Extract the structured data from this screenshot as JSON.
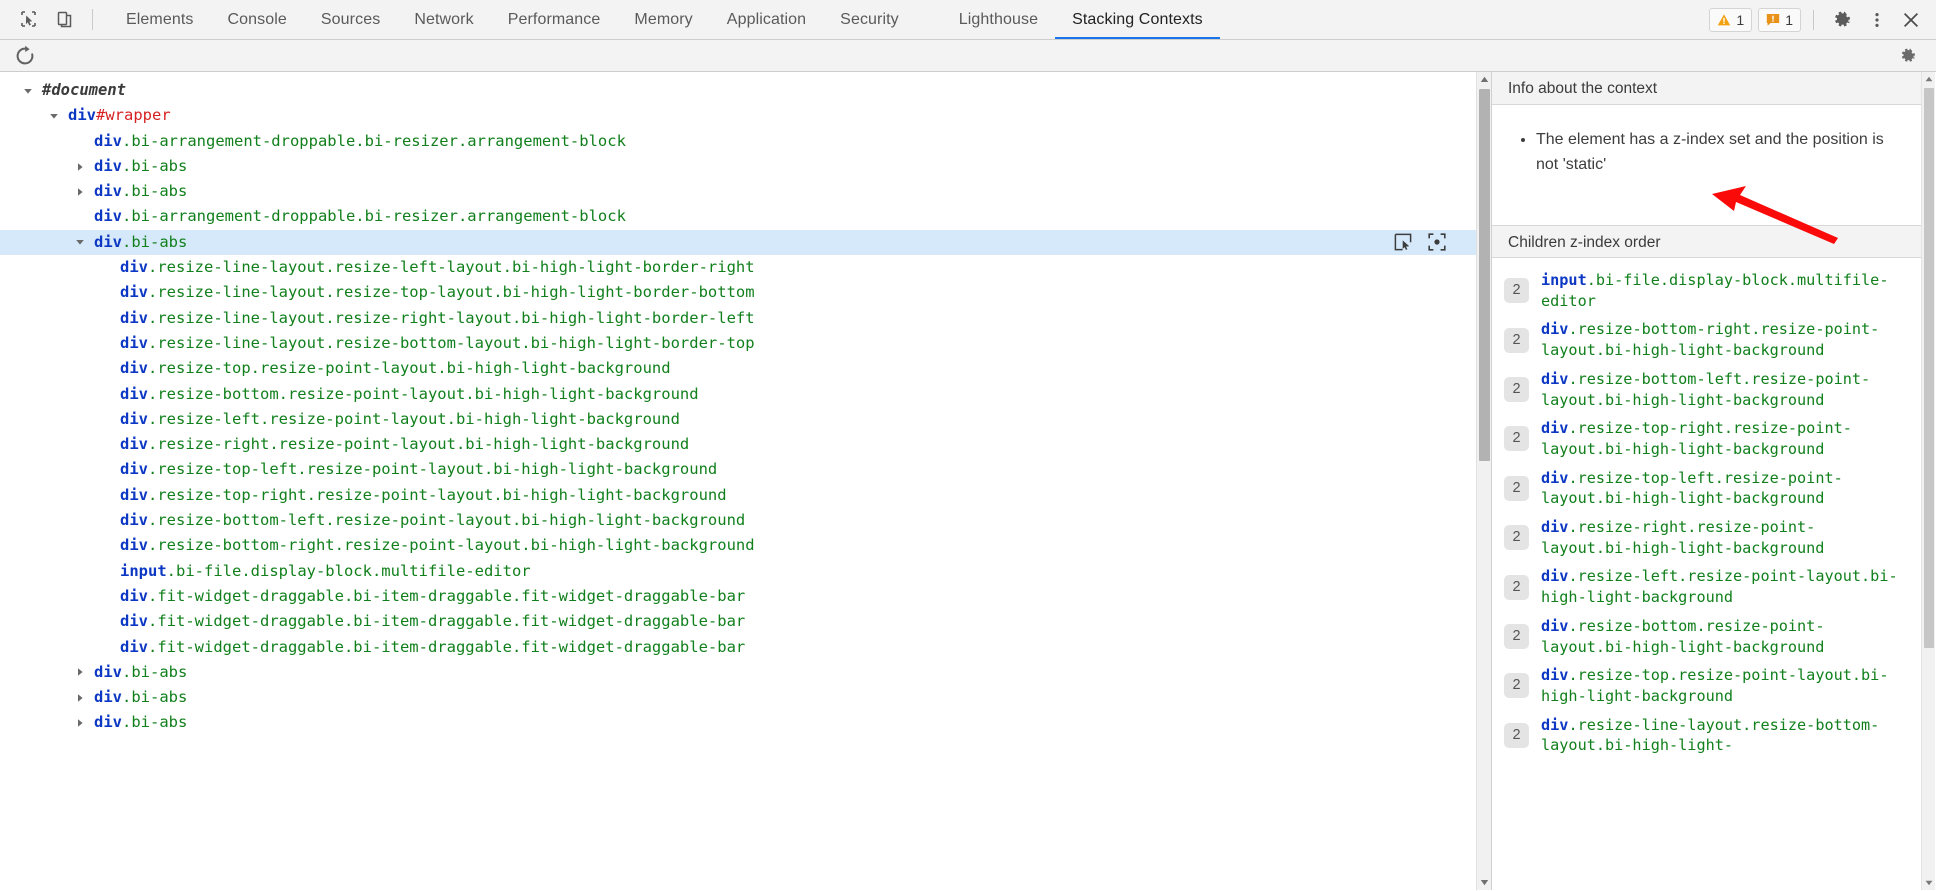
{
  "toolbar": {
    "inspect_icon": "inspect-cursor-icon",
    "device_icon": "device-toolbar-icon",
    "tabs": [
      {
        "label": "Elements",
        "active": false
      },
      {
        "label": "Console",
        "active": false
      },
      {
        "label": "Sources",
        "active": false
      },
      {
        "label": "Network",
        "active": false
      },
      {
        "label": "Performance",
        "active": false
      },
      {
        "label": "Memory",
        "active": false
      },
      {
        "label": "Application",
        "active": false
      },
      {
        "label": "Security",
        "active": false
      },
      {
        "label": "Lighthouse",
        "active": false
      },
      {
        "label": "Stacking Contexts",
        "active": true
      }
    ],
    "warning_count": "1",
    "error_count": "1",
    "warning_icon": "warning-triangle-icon",
    "error_icon": "error-message-icon",
    "settings_icon": "gear-icon",
    "more_icon": "kebab-menu-icon",
    "close_icon": "close-icon",
    "accent_color": "#1a73e8",
    "warning_color": "#f2a010",
    "error_color": "#e8921a"
  },
  "subbar": {
    "reload_icon": "reload-icon",
    "settings_icon": "gear-icon"
  },
  "tree": {
    "rows": [
      {
        "indent": 0,
        "twisty": "open",
        "kind": "document",
        "text": "#document"
      },
      {
        "indent": 1,
        "twisty": "open",
        "kind": "element",
        "tag": "div",
        "id": "#wrapper",
        "classes": ""
      },
      {
        "indent": 2,
        "twisty": "none",
        "kind": "element",
        "tag": "div",
        "id": "",
        "classes": ".bi-arrangement-droppable.bi-resizer.arrangement-block"
      },
      {
        "indent": 2,
        "twisty": "closed",
        "kind": "element",
        "tag": "div",
        "id": "",
        "classes": ".bi-abs"
      },
      {
        "indent": 2,
        "twisty": "closed",
        "kind": "element",
        "tag": "div",
        "id": "",
        "classes": ".bi-abs"
      },
      {
        "indent": 2,
        "twisty": "none",
        "kind": "element",
        "tag": "div",
        "id": "",
        "classes": ".bi-arrangement-droppable.bi-resizer.arrangement-block"
      },
      {
        "indent": 2,
        "twisty": "open",
        "kind": "element",
        "tag": "div",
        "id": "",
        "classes": ".bi-abs",
        "selected": true
      },
      {
        "indent": 3,
        "twisty": "none",
        "kind": "element",
        "tag": "div",
        "id": "",
        "classes": ".resize-line-layout.resize-left-layout.bi-high-light-border-right"
      },
      {
        "indent": 3,
        "twisty": "none",
        "kind": "element",
        "tag": "div",
        "id": "",
        "classes": ".resize-line-layout.resize-top-layout.bi-high-light-border-bottom"
      },
      {
        "indent": 3,
        "twisty": "none",
        "kind": "element",
        "tag": "div",
        "id": "",
        "classes": ".resize-line-layout.resize-right-layout.bi-high-light-border-left"
      },
      {
        "indent": 3,
        "twisty": "none",
        "kind": "element",
        "tag": "div",
        "id": "",
        "classes": ".resize-line-layout.resize-bottom-layout.bi-high-light-border-top"
      },
      {
        "indent": 3,
        "twisty": "none",
        "kind": "element",
        "tag": "div",
        "id": "",
        "classes": ".resize-top.resize-point-layout.bi-high-light-background"
      },
      {
        "indent": 3,
        "twisty": "none",
        "kind": "element",
        "tag": "div",
        "id": "",
        "classes": ".resize-bottom.resize-point-layout.bi-high-light-background"
      },
      {
        "indent": 3,
        "twisty": "none",
        "kind": "element",
        "tag": "div",
        "id": "",
        "classes": ".resize-left.resize-point-layout.bi-high-light-background"
      },
      {
        "indent": 3,
        "twisty": "none",
        "kind": "element",
        "tag": "div",
        "id": "",
        "classes": ".resize-right.resize-point-layout.bi-high-light-background"
      },
      {
        "indent": 3,
        "twisty": "none",
        "kind": "element",
        "tag": "div",
        "id": "",
        "classes": ".resize-top-left.resize-point-layout.bi-high-light-background"
      },
      {
        "indent": 3,
        "twisty": "none",
        "kind": "element",
        "tag": "div",
        "id": "",
        "classes": ".resize-top-right.resize-point-layout.bi-high-light-background"
      },
      {
        "indent": 3,
        "twisty": "none",
        "kind": "element",
        "tag": "div",
        "id": "",
        "classes": ".resize-bottom-left.resize-point-layout.bi-high-light-background"
      },
      {
        "indent": 3,
        "twisty": "none",
        "kind": "element",
        "tag": "div",
        "id": "",
        "classes": ".resize-bottom-right.resize-point-layout.bi-high-light-background"
      },
      {
        "indent": 3,
        "twisty": "none",
        "kind": "element",
        "tag": "input",
        "id": "",
        "classes": ".bi-file.display-block.multifile-editor"
      },
      {
        "indent": 3,
        "twisty": "none",
        "kind": "element",
        "tag": "div",
        "id": "",
        "classes": ".fit-widget-draggable.bi-item-draggable.fit-widget-draggable-bar"
      },
      {
        "indent": 3,
        "twisty": "none",
        "kind": "element",
        "tag": "div",
        "id": "",
        "classes": ".fit-widget-draggable.bi-item-draggable.fit-widget-draggable-bar"
      },
      {
        "indent": 3,
        "twisty": "none",
        "kind": "element",
        "tag": "div",
        "id": "",
        "classes": ".fit-widget-draggable.bi-item-draggable.fit-widget-draggable-bar"
      },
      {
        "indent": 2,
        "twisty": "closed",
        "kind": "element",
        "tag": "div",
        "id": "",
        "classes": ".bi-abs"
      },
      {
        "indent": 2,
        "twisty": "closed",
        "kind": "element",
        "tag": "div",
        "id": "",
        "classes": ".bi-abs"
      },
      {
        "indent": 2,
        "twisty": "closed",
        "kind": "element",
        "tag": "div",
        "id": "",
        "classes": ".bi-abs"
      }
    ],
    "selected_row_icons": {
      "select_icon": "select-node-icon",
      "scroll_into_view_icon": "scroll-into-view-icon"
    }
  },
  "info_panel": {
    "info_header": "Info about the context",
    "info_bullets": [
      "The element has a z-index set and the position is not 'static'"
    ],
    "children_header": "Children z-index order",
    "children": [
      {
        "z": "2",
        "tag": "input",
        "classes": ".bi-file.display-block.multifile-editor"
      },
      {
        "z": "2",
        "tag": "div",
        "classes": ".resize-bottom-right.resize-point-layout.bi-high-light-background"
      },
      {
        "z": "2",
        "tag": "div",
        "classes": ".resize-bottom-left.resize-point-layout.bi-high-light-background"
      },
      {
        "z": "2",
        "tag": "div",
        "classes": ".resize-top-right.resize-point-layout.bi-high-light-background"
      },
      {
        "z": "2",
        "tag": "div",
        "classes": ".resize-top-left.resize-point-layout.bi-high-light-background"
      },
      {
        "z": "2",
        "tag": "div",
        "classes": ".resize-right.resize-point-layout.bi-high-light-background"
      },
      {
        "z": "2",
        "tag": "div",
        "classes": ".resize-left.resize-point-layout.bi-high-light-background"
      },
      {
        "z": "2",
        "tag": "div",
        "classes": ".resize-bottom.resize-point-layout.bi-high-light-background"
      },
      {
        "z": "2",
        "tag": "div",
        "classes": ".resize-top.resize-point-layout.bi-high-light-background"
      },
      {
        "z": "2",
        "tag": "div",
        "classes": ".resize-line-layout.resize-bottom-layout.bi-high-light-"
      }
    ]
  },
  "annotation": {
    "arrow_color": "#fb0a0a",
    "arrow_name": "red-pointer-arrow"
  },
  "colors": {
    "tag_name": "#0d38c4",
    "tag_id": "#d62222",
    "tag_class": "#11801c",
    "selection_bg": "#d6e9fb"
  }
}
